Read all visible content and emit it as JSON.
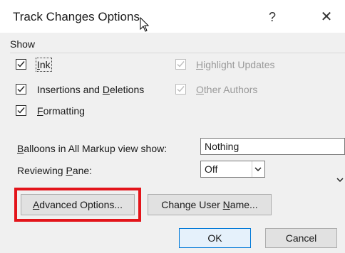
{
  "dialog": {
    "title": "Track Changes Options",
    "help_label": "?",
    "close_label": "✕"
  },
  "show_group": {
    "label": "Show",
    "options": {
      "ink": {
        "pre": "",
        "accel": "I",
        "post": "nk",
        "checked": true,
        "enabled": true
      },
      "highlight_updates": {
        "pre": "",
        "accel": "H",
        "post": "ighlight Updates",
        "checked": true,
        "enabled": false
      },
      "insertions_deletions": {
        "pre": "Insertions and ",
        "accel": "D",
        "post": "eletions",
        "checked": true,
        "enabled": true
      },
      "other_authors": {
        "pre": "",
        "accel": "O",
        "post": "ther Authors",
        "checked": true,
        "enabled": false
      },
      "formatting": {
        "pre": "",
        "accel": "F",
        "post": "ormatting",
        "checked": true,
        "enabled": true
      }
    }
  },
  "balloons": {
    "label_pre": "",
    "label_accel": "B",
    "label_post": "alloons in All Markup view show:",
    "value": "Nothing"
  },
  "reviewing_pane": {
    "label_pre": "Reviewing ",
    "label_accel": "P",
    "label_post": "ane:",
    "value": "Off"
  },
  "buttons": {
    "advanced": {
      "pre": "",
      "accel": "A",
      "post": "dvanced Options..."
    },
    "change_user": {
      "pre": "Change User ",
      "accel": "N",
      "post": "ame..."
    },
    "ok": "OK",
    "cancel": "Cancel"
  },
  "colors": {
    "highlight_box": "#e3141a",
    "dialog_bg": "#f0f0f0",
    "default_button_border": "#0078d7"
  }
}
